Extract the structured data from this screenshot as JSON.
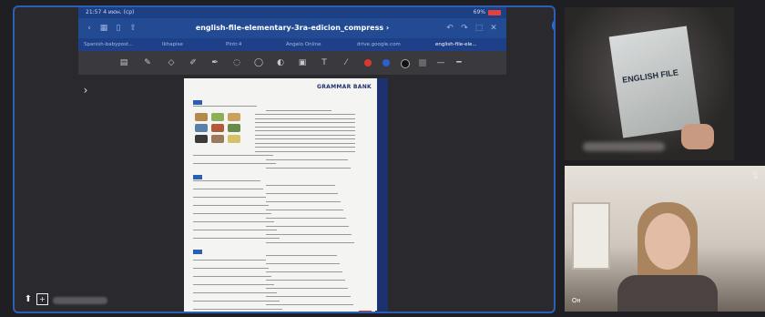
{
  "share": {
    "status_time": "21:57 4 июн. (ср)",
    "status_battery": "69%",
    "document_title": "english-file-elementary-3ra-edicion_compress",
    "tabs": [
      {
        "label": "Spanish-babypost...",
        "active": false
      },
      {
        "label": "Ikhapise",
        "active": false
      },
      {
        "label": "Pintr.4",
        "active": false
      },
      {
        "label": "Angelo Online",
        "active": false
      },
      {
        "label": "drive.google.com",
        "active": false
      },
      {
        "label": "english-file-ele...",
        "active": true
      }
    ],
    "toolbar_icons": [
      "sidebar-toggle-icon",
      "pencil-icon",
      "eraser-icon",
      "pen-icon",
      "marker-icon",
      "lasso-icon",
      "bubble-icon",
      "shapes-icon",
      "image-icon",
      "text-icon",
      "highlighter-icon"
    ],
    "colors": {
      "accent": "#2b5fb4",
      "red": "#d93a2f",
      "blue": "#2a5fd6",
      "black": "#111111",
      "white": "#ffffff",
      "gray": "#666666"
    },
    "page_header": "GRAMMAR BANK"
  },
  "video": {
    "participant_two_label": "Он"
  }
}
